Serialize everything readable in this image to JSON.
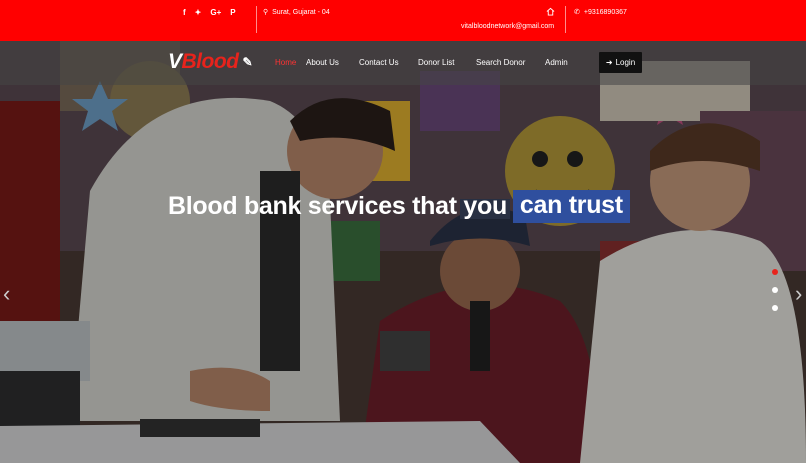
{
  "topbar": {
    "social_icons": [
      "facebook-icon",
      "twitter-icon",
      "google-plus-icon",
      "pinterest-icon"
    ],
    "social_glyphs": [
      "f",
      "🐦",
      "G+",
      "P"
    ],
    "address": "Surat, Gujarat - 04",
    "email": "vitalbloodnetwork@gmail.com",
    "phone": "+9316890367"
  },
  "brand": {
    "logo_prefix": "V",
    "logo_suffix": "Blood"
  },
  "nav": {
    "items": [
      "Home",
      "About Us",
      "Contact Us",
      "Donor List",
      "Search Donor",
      "Admin"
    ],
    "active": "Home",
    "login_label": "Login"
  },
  "hero": {
    "headline_main": "Blood bank services that you",
    "headline_highlight": "can trust",
    "slide_count": 3,
    "active_slide": 1
  },
  "colors": {
    "topbar": "#ff0000",
    "accent": "#e8231c",
    "highlight": "#2f4f9e",
    "login_bg": "#111111"
  }
}
